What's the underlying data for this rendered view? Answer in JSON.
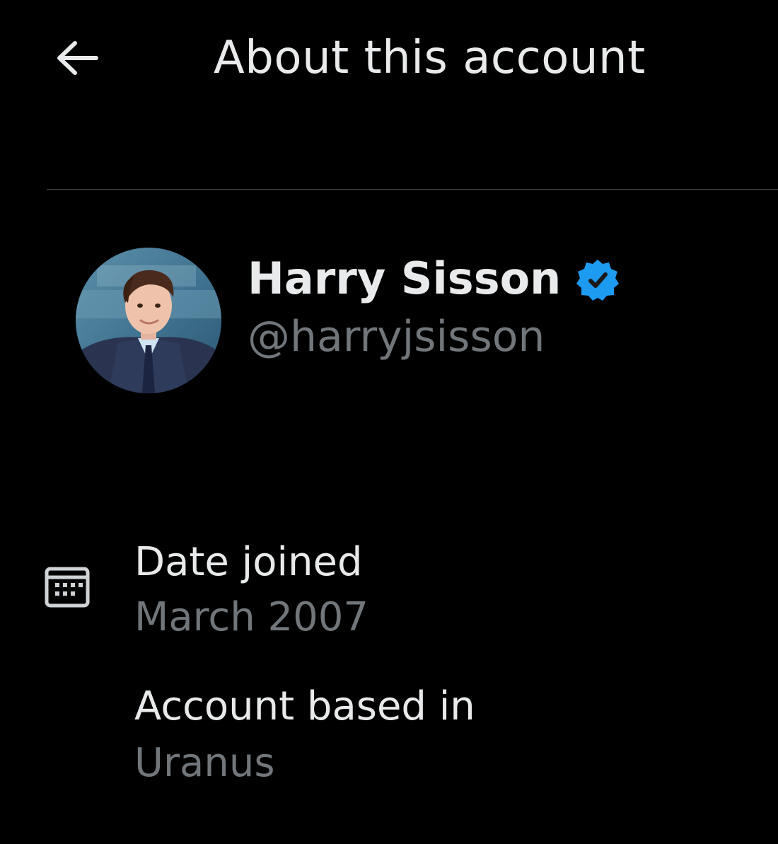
{
  "header": {
    "title": "About this account",
    "back_icon": "arrow-left-icon"
  },
  "profile": {
    "display_name": "Harry Sisson",
    "handle": "@harryjsisson",
    "verified": true,
    "verified_color": "#1d9bf0"
  },
  "details": {
    "date_joined_label": "Date joined",
    "date_joined_value": "March 2007",
    "based_in_label": "Account based in",
    "based_in_value": "Uranus",
    "calendar_icon": "calendar-icon"
  },
  "colors": {
    "background": "#000000",
    "primary_text": "#e7e9ea",
    "secondary_text": "#71767b",
    "divider": "#2f3336"
  }
}
